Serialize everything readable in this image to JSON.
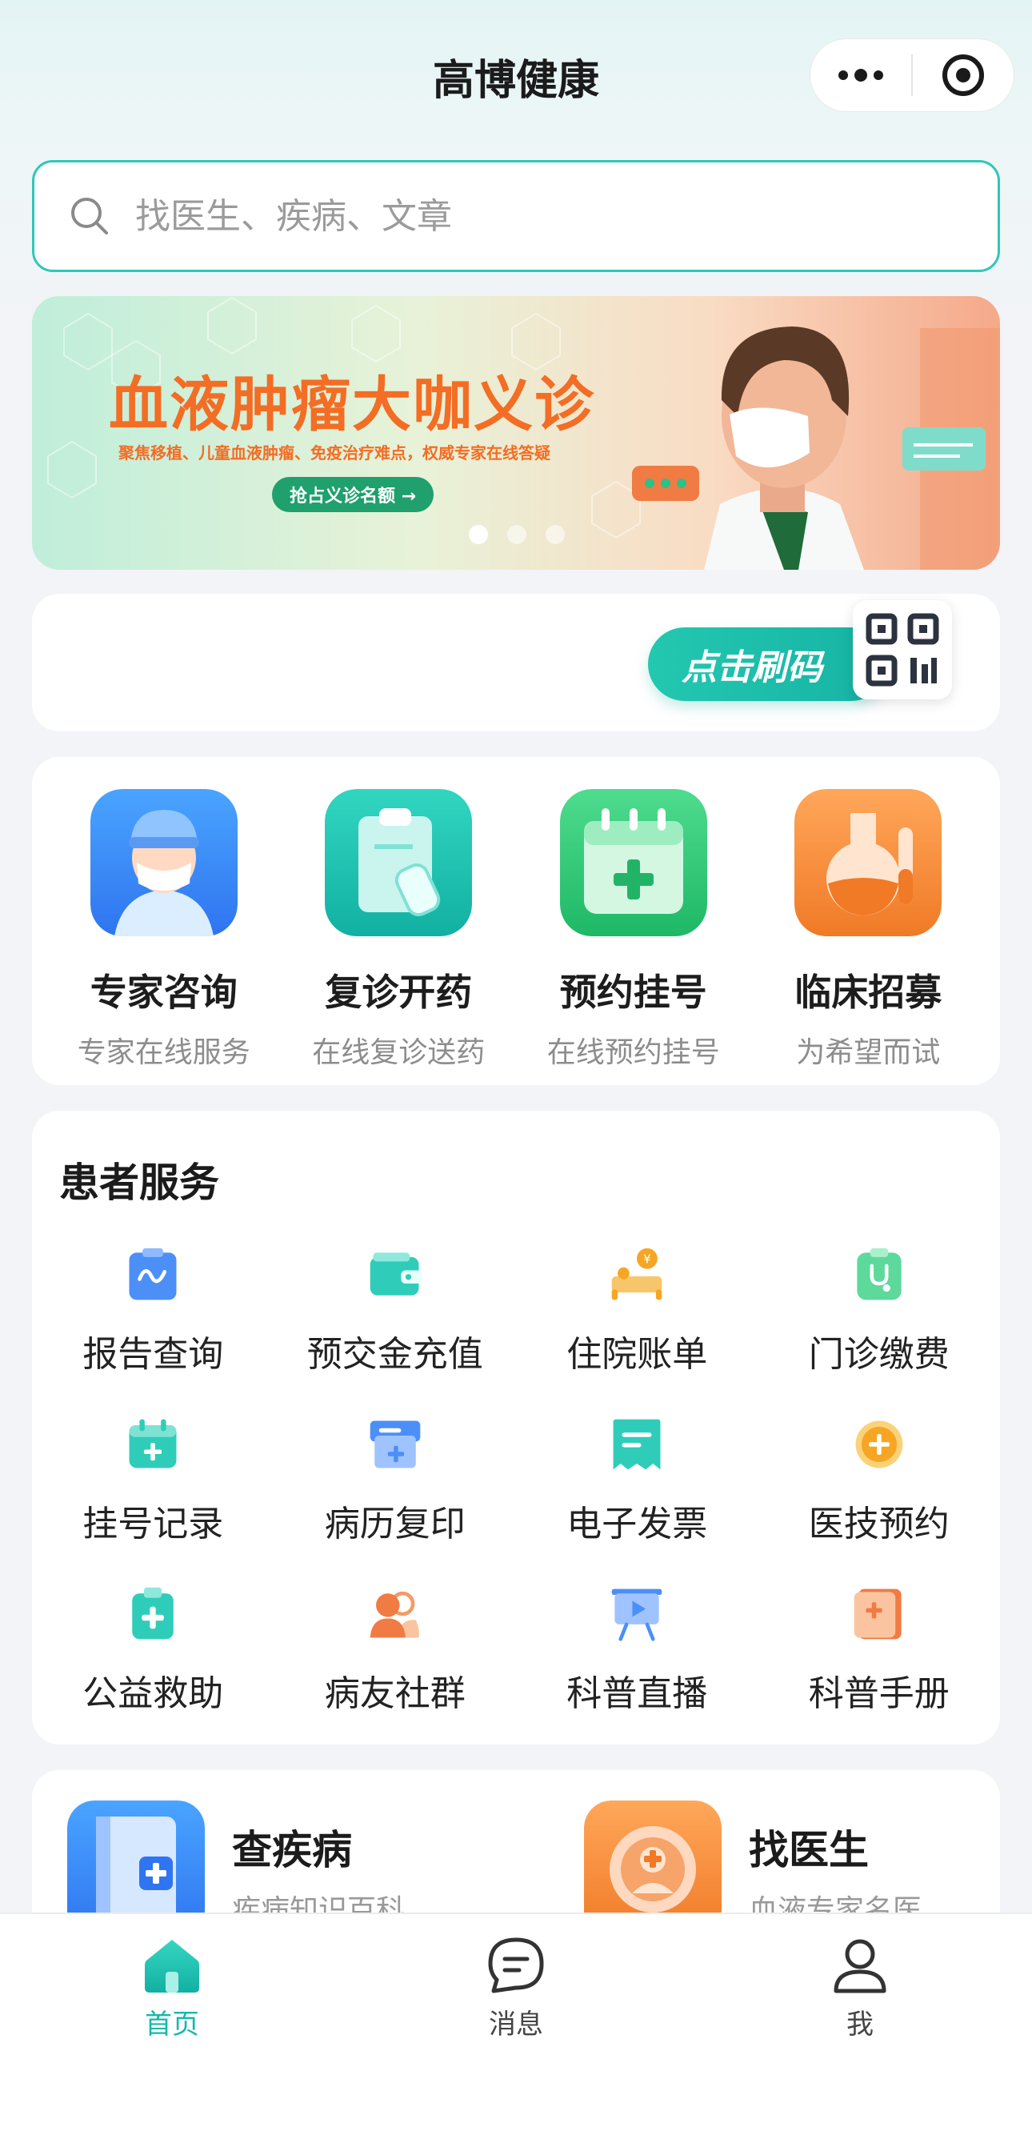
{
  "header": {
    "title": "高博健康"
  },
  "search": {
    "placeholder": "找医生、疾病、文章"
  },
  "banner": {
    "title": "血液肿瘤大咖义诊",
    "subtitle": "聚焦移植、儿童血液肿瘤、免疫治疗难点，权威专家在线答疑",
    "button": "抢占义诊名额 →",
    "slide_count": 3,
    "active_slide": 1
  },
  "qr": {
    "button": "点击刷码"
  },
  "main_services": [
    {
      "title": "专家咨询",
      "subtitle": "专家在线服务",
      "icon": "doctor-icon"
    },
    {
      "title": "复诊开药",
      "subtitle": "在线复诊送药",
      "icon": "prescription-icon"
    },
    {
      "title": "预约挂号",
      "subtitle": "在线预约挂号",
      "icon": "calendar-plus-icon"
    },
    {
      "title": "临床招募",
      "subtitle": "为希望而试",
      "icon": "flask-icon"
    }
  ],
  "patient_services": {
    "title": "患者服务",
    "items": [
      {
        "label": "报告查询",
        "icon": "report-icon"
      },
      {
        "label": "预交金充值",
        "icon": "wallet-icon"
      },
      {
        "label": "住院账单",
        "icon": "hospital-bed-icon"
      },
      {
        "label": "门诊缴费",
        "icon": "clipboard-stethoscope-icon"
      },
      {
        "label": "挂号记录",
        "icon": "calendar-icon"
      },
      {
        "label": "病历复印",
        "icon": "printer-icon"
      },
      {
        "label": "电子发票",
        "icon": "invoice-icon"
      },
      {
        "label": "医技预约",
        "icon": "appointment-icon"
      },
      {
        "label": "公益救助",
        "icon": "medical-kit-icon"
      },
      {
        "label": "病友社群",
        "icon": "community-icon"
      },
      {
        "label": "科普直播",
        "icon": "live-broadcast-icon"
      },
      {
        "label": "科普手册",
        "icon": "handbook-icon"
      }
    ]
  },
  "quick_links": [
    {
      "title": "查疾病",
      "subtitle": "疾病知识百科",
      "icon": "book-plus-icon"
    },
    {
      "title": "找医生",
      "subtitle": "血液专家名医",
      "icon": "doctor-search-icon"
    }
  ],
  "tabbar": [
    {
      "label": "首页",
      "icon": "home-icon",
      "active": true
    },
    {
      "label": "消息",
      "icon": "message-icon",
      "active": false
    },
    {
      "label": "我",
      "icon": "profile-icon",
      "active": false
    }
  ],
  "colors": {
    "accent": "#18b8a8",
    "banner_title": "#f36d24",
    "banner_button": "#1fa06c"
  }
}
